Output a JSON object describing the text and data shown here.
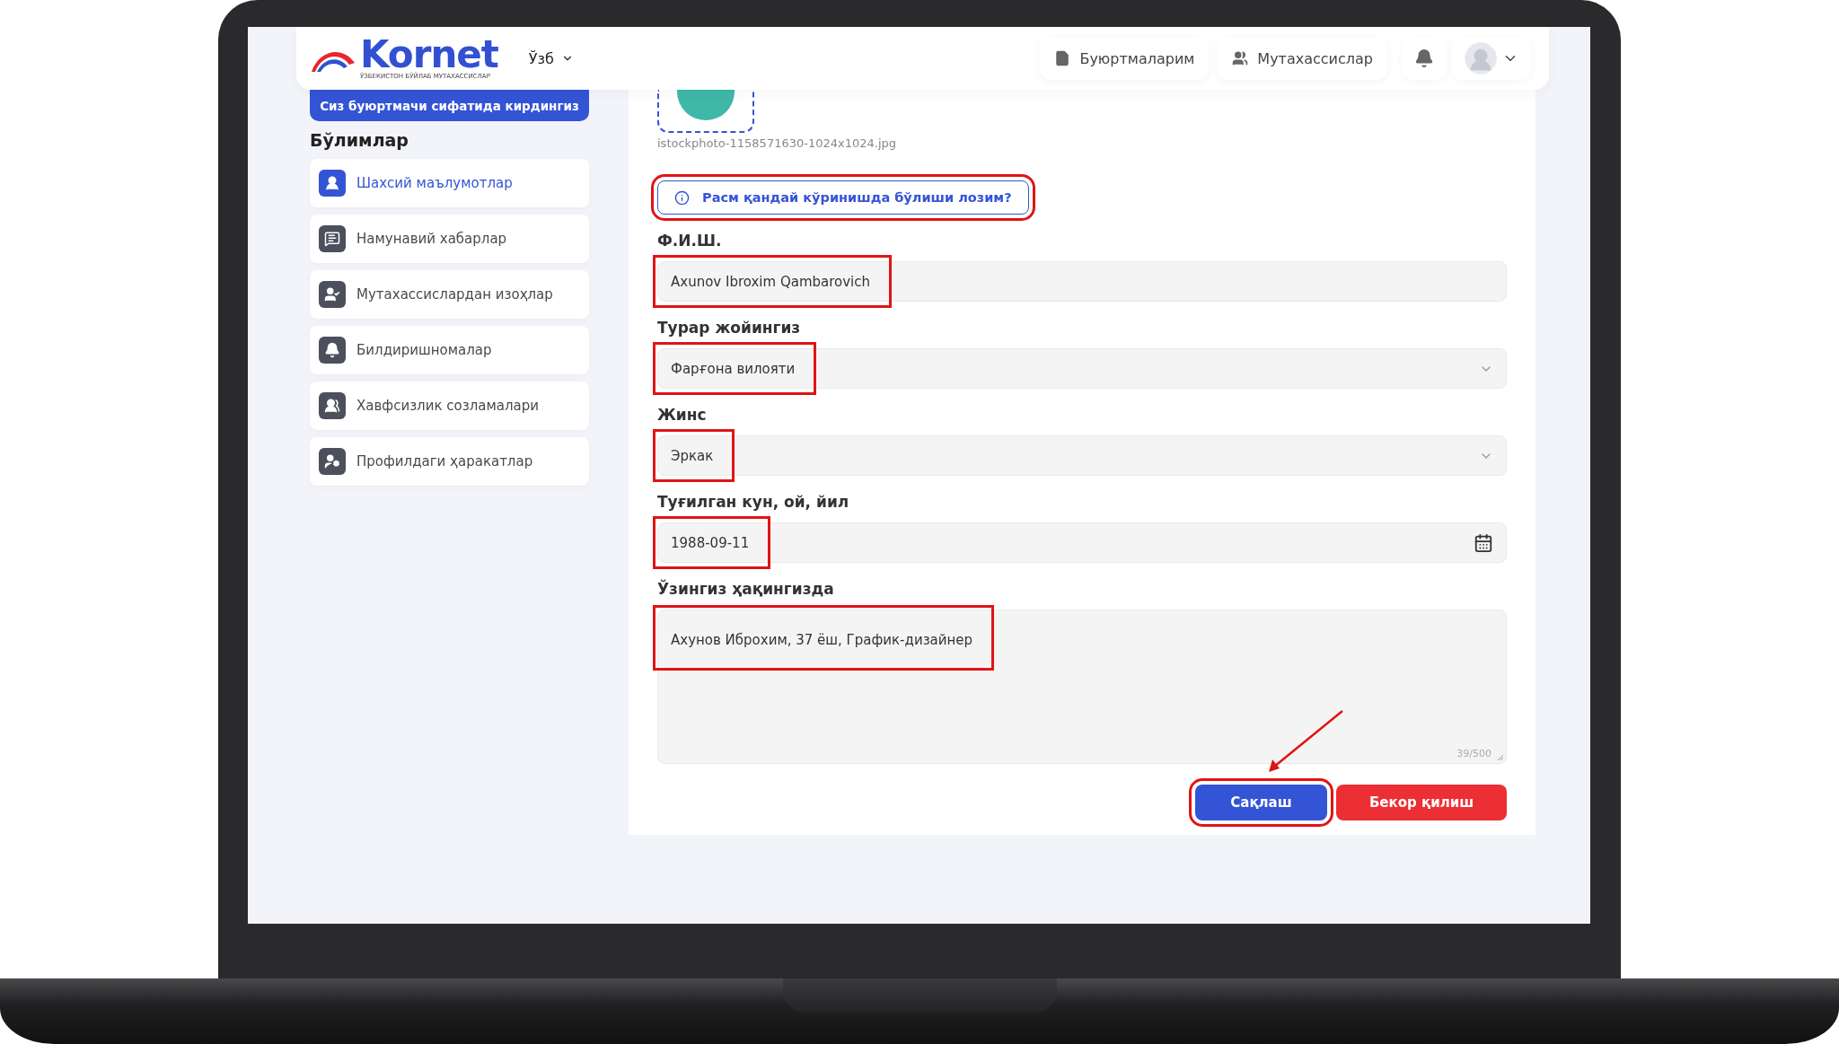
{
  "header": {
    "logo": {
      "name": "Kornet",
      "tagline": "ЎЗБЕКИСТОН БЎЙЛАБ МУТАХАССИСЛАР"
    },
    "language": "Ўзб",
    "nav": [
      {
        "label": "Буюртмаларим",
        "kind": "orders"
      },
      {
        "label": "Мутахассислар",
        "kind": "specialists"
      }
    ]
  },
  "sidebar": {
    "banner": "Сиз буюртмачи сифатида кирдингиз",
    "title": "Бўлимлар",
    "items": [
      {
        "label": "Шахсий маълумотлар",
        "kind": "person",
        "selected": true
      },
      {
        "label": "Намунавий хабарлар",
        "kind": "messages",
        "selected": false
      },
      {
        "label": "Мутахассислардан изоҳлар",
        "kind": "reviews",
        "selected": false
      },
      {
        "label": "Билдиришномалар",
        "kind": "notifications",
        "selected": false
      },
      {
        "label": "Хавфсизлик созламалари",
        "kind": "security",
        "selected": false
      },
      {
        "label": "Профилдаги ҳаракатлар",
        "kind": "actions",
        "selected": false
      }
    ]
  },
  "form": {
    "photo": {
      "filename": "istockphoto-1158571630-1024x1024.jpg"
    },
    "photo_hint": {
      "label": "Расм қандай кўринишда бўлиши лозим?",
      "highlighted": true
    },
    "fields": [
      {
        "label": "Ф.И.Ш.",
        "kind": "text",
        "value": "Axunov Ibroxim Qambarovich",
        "highlighted": true
      },
      {
        "label": "Турар жойингиз",
        "kind": "select",
        "value": "Фарғона вилояти",
        "highlighted": true
      },
      {
        "label": "Жинс",
        "kind": "select",
        "value": "Эркак",
        "highlighted": true
      },
      {
        "label": "Туғилган кун, ой, йил",
        "kind": "date",
        "value": "1988-09-11",
        "highlighted": true
      },
      {
        "label": "Ўзингиз ҳақингизда",
        "kind": "textarea",
        "value": "Ахунов Иброхим, 37 ёш, График-дизайнер",
        "counter": "39/500",
        "highlighted": true
      }
    ],
    "buttons": [
      {
        "label": "Сақлаш",
        "kind": "primary",
        "highlighted": true
      },
      {
        "label": "Бекор қилиш",
        "kind": "danger",
        "highlighted": false
      }
    ]
  },
  "annotation_arrow": true
}
